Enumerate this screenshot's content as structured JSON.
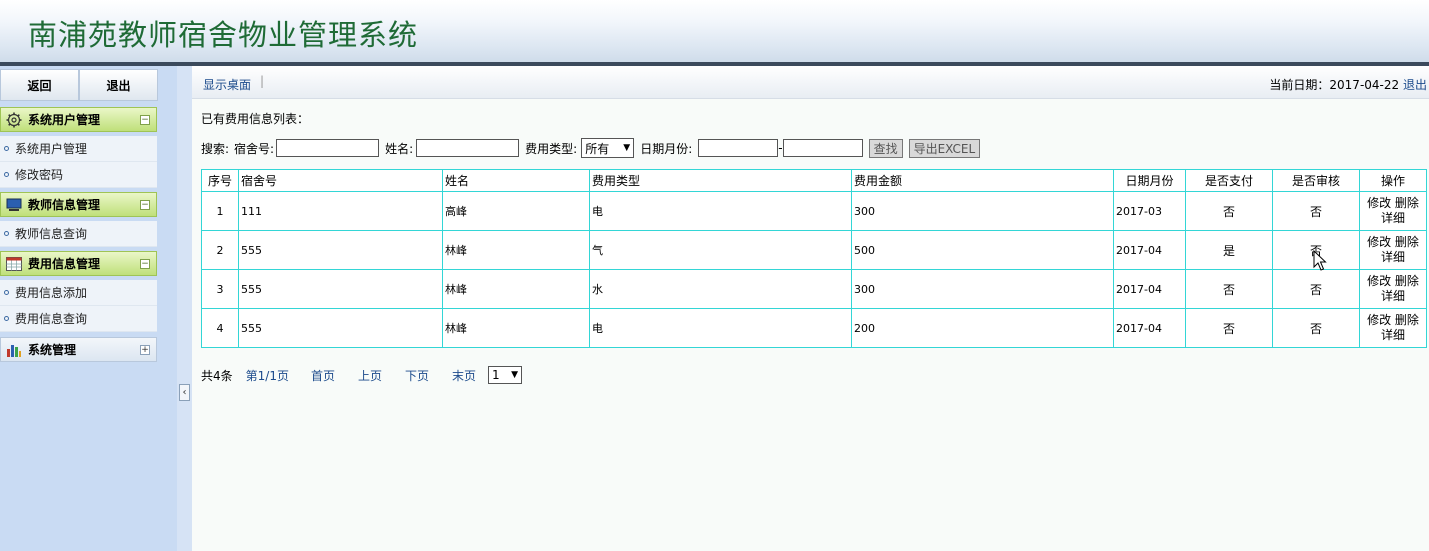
{
  "header": {
    "title": "南浦苑教师宿舍物业管理系统"
  },
  "sidebar": {
    "back_label": "返回",
    "exit_label": "退出",
    "groups": [
      {
        "title": "系统用户管理",
        "icon": "gear-icon",
        "toggle": "−",
        "items": [
          "系统用户管理",
          "修改密码"
        ]
      },
      {
        "title": "教师信息管理",
        "icon": "monitor-icon",
        "toggle": "−",
        "items": [
          "教师信息查询"
        ]
      },
      {
        "title": "费用信息管理",
        "icon": "calendar-icon",
        "toggle": "−",
        "items": [
          "费用信息添加",
          "费用信息查询"
        ]
      },
      {
        "title": "系统管理",
        "icon": "chart-icon",
        "toggle": "+",
        "items": []
      }
    ]
  },
  "topbar": {
    "desk_link": "显示桌面",
    "separator": "|",
    "date_label": "当前日期：2017-04-22",
    "logout_label": "退出"
  },
  "main": {
    "list_title": "已有费用信息列表：",
    "search": {
      "label": "搜索:",
      "dorm_label": "宿舍号:",
      "dorm_value": "",
      "name_label": "姓名:",
      "name_value": "",
      "type_label": "费用类型:",
      "type_selected": "所有",
      "date_label": "日期月份:",
      "date_from": "",
      "date_dash": "-",
      "date_to": "",
      "find_button": "查找",
      "export_button": "导出EXCEL"
    },
    "table": {
      "headers": [
        "序号",
        "宿舍号",
        "姓名",
        "费用类型",
        "费用金额",
        "日期月份",
        "是否支付",
        "是否审核",
        "操作"
      ],
      "rows": [
        {
          "no": "1",
          "dorm": "111",
          "name": "高峰",
          "type": "电",
          "amount": "300",
          "month": "2017-03",
          "paid": "否",
          "audited": "否"
        },
        {
          "no": "2",
          "dorm": "555",
          "name": "林峰",
          "type": "气",
          "amount": "500",
          "month": "2017-04",
          "paid": "是",
          "audited": "否"
        },
        {
          "no": "3",
          "dorm": "555",
          "name": "林峰",
          "type": "水",
          "amount": "300",
          "month": "2017-04",
          "paid": "否",
          "audited": "否"
        },
        {
          "no": "4",
          "dorm": "555",
          "name": "林峰",
          "type": "电",
          "amount": "200",
          "month": "2017-04",
          "paid": "否",
          "audited": "否"
        }
      ],
      "op_edit": "修改",
      "op_delete": "删除",
      "op_detail": "详细"
    },
    "pager": {
      "total": "共4条",
      "page": "第1/1页",
      "first": "首页",
      "prev": "上页",
      "next": "下页",
      "last": "末页",
      "selected": "1"
    }
  },
  "colors": {
    "title_green": "#1f6b36",
    "sidebar_bg": "#c9dbf3",
    "table_border": "#33d6d6",
    "link_blue": "#1c4b8c"
  }
}
